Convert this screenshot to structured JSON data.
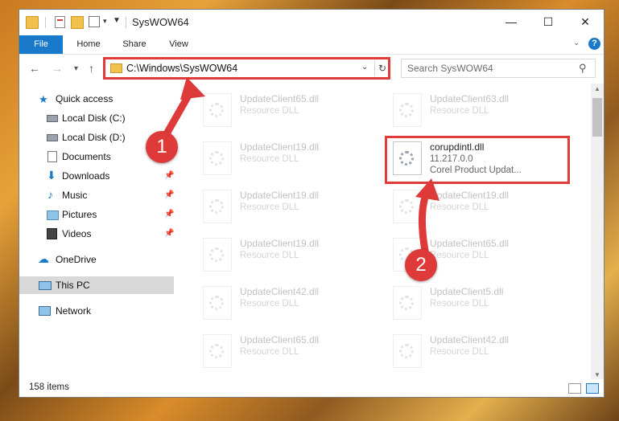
{
  "window": {
    "title": "SysWOW64"
  },
  "ribbon": {
    "tabs": [
      "File",
      "Home",
      "Share",
      "View"
    ],
    "help": "?"
  },
  "navigation": {
    "address": "C:\\Windows\\SysWOW64",
    "search_placeholder": "Search SysWOW64"
  },
  "sidebar": {
    "quick_access": "Quick access",
    "items": [
      {
        "label": "Local Disk (C:)",
        "icon": "drive-icon",
        "pinned": false
      },
      {
        "label": "Local Disk (D:)",
        "icon": "drive-icon",
        "pinned": false
      },
      {
        "label": "Documents",
        "icon": "documents-icon",
        "pinned": true
      },
      {
        "label": "Downloads",
        "icon": "downloads-icon",
        "pinned": true
      },
      {
        "label": "Music",
        "icon": "music-icon",
        "pinned": true
      },
      {
        "label": "Pictures",
        "icon": "pictures-icon",
        "pinned": true
      },
      {
        "label": "Videos",
        "icon": "videos-icon",
        "pinned": true
      }
    ],
    "onedrive": "OneDrive",
    "this_pc": "This PC",
    "network": "Network"
  },
  "files": [
    {
      "name": "UpdateClient65.dll",
      "type": "Resource DLL"
    },
    {
      "name": "UpdateClient63.dll",
      "type": "Resource DLL"
    },
    {
      "name": "UpdateClient19.dll",
      "type": "Resource DLL"
    },
    {
      "name": "corupdintl.dll",
      "version": "11.217.0.0",
      "type": "Corel Product Updat..."
    },
    {
      "name": "UpdateClient19.dll",
      "type": "Resource DLL"
    },
    {
      "name": "UpdateClient19.dll",
      "type": "Resource DLL"
    },
    {
      "name": "UpdateClient19.dll",
      "type": "Resource DLL"
    },
    {
      "name": "UpdateClient65.dll",
      "type": "Resource DLL"
    },
    {
      "name": "UpdateClient42.dll",
      "type": "Resource DLL"
    },
    {
      "name": "UpdateClient5.dll",
      "type": "Resource DLL"
    },
    {
      "name": "UpdateClient65.dll",
      "type": "Resource DLL"
    },
    {
      "name": "UpdateClient42.dll",
      "type": "Resource DLL"
    }
  ],
  "status": {
    "item_count": "158 items"
  },
  "callouts": [
    "1",
    "2"
  ],
  "colors": {
    "accent": "#1979ca",
    "highlight": "#e03c3c",
    "selected": "#d9d9d9"
  }
}
